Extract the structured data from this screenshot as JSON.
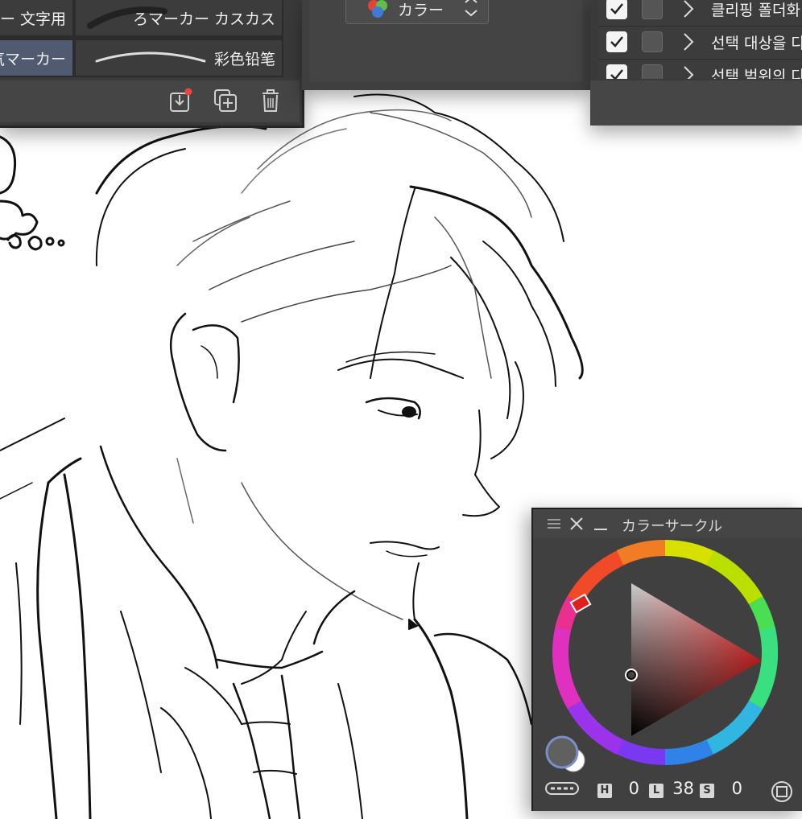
{
  "brush_panel": {
    "items": [
      {
        "label": "ー 文字用"
      },
      {
        "label": "ろマーカー カスカス"
      },
      {
        "label": "気マーカー"
      },
      {
        "label": "彩色铅笔"
      }
    ],
    "tools": [
      "import-icon",
      "duplicate-icon",
      "trash-icon"
    ]
  },
  "color_set_panel": {
    "select_value": "カラー"
  },
  "layer_panel": {
    "layers": [
      {
        "name": "클리핑 폴더화",
        "checked": true
      },
      {
        "name": "선택 대상을 다",
        "checked": true
      },
      {
        "name": "선택 범위의 다",
        "checked": true
      }
    ]
  },
  "color_circle_panel": {
    "title": "カラーサークル",
    "hsl": {
      "h_label": "H",
      "h_value": "0",
      "l_label": "L",
      "l_value": "38",
      "s_label": "S",
      "s_value": "0"
    },
    "main_color": "#606060",
    "sub_color": "#ffffff",
    "accent_color": "#7a8fc8"
  }
}
